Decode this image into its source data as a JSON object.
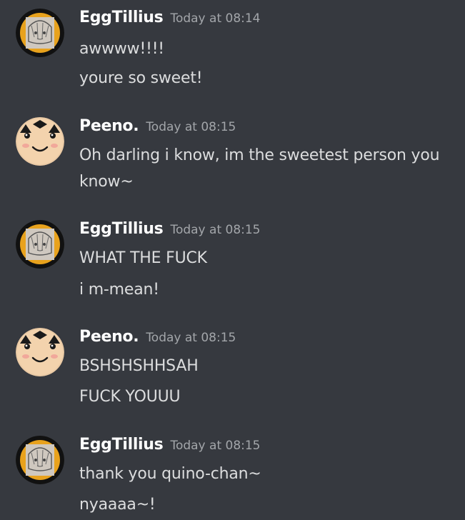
{
  "messages": [
    {
      "author": "EggTillius",
      "avatar": "eggtillius-avatar",
      "timestamp": "Today at 08:14",
      "lines": [
        "awwww!!!!",
        "youre so sweet!"
      ]
    },
    {
      "author": "Peeno.",
      "avatar": "peeno-avatar",
      "timestamp": "Today at 08:15",
      "lines": [
        "Oh darling i know, im the sweetest person you know~"
      ]
    },
    {
      "author": "EggTillius",
      "avatar": "eggtillius-avatar",
      "timestamp": "Today at 08:15",
      "lines": [
        "WHAT THE FUCK",
        "i m-mean!"
      ]
    },
    {
      "author": "Peeno.",
      "avatar": "peeno-avatar",
      "timestamp": "Today at 08:15",
      "lines": [
        "BSHSHSHHSAH",
        "FUCK YOUUU"
      ]
    },
    {
      "author": "EggTillius",
      "avatar": "eggtillius-avatar",
      "timestamp": "Today at 08:15",
      "lines": [
        "thank you quino-chan~",
        "nyaaaa~!"
      ]
    }
  ],
  "colors": {
    "background": "#36393f",
    "username": "#ffffff",
    "timestamp": "#a3a6aa",
    "message_text": "#dcddde"
  }
}
